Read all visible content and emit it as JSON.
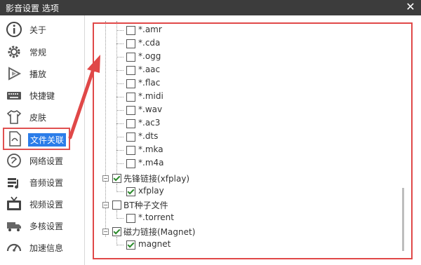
{
  "window": {
    "title": "影音设置 选项",
    "close_glyph": "✕"
  },
  "sidebar": {
    "items": [
      {
        "label": "关于",
        "icon": "info-icon"
      },
      {
        "label": "常规",
        "icon": "gear-icon"
      },
      {
        "label": "播放",
        "icon": "play-icon"
      },
      {
        "label": "快捷键",
        "icon": "keyboard-icon"
      },
      {
        "label": "皮肤",
        "icon": "tshirt-icon"
      },
      {
        "label": "文件关联",
        "icon": "file-link-icon",
        "active": true
      },
      {
        "label": "网络设置",
        "icon": "network-icon"
      },
      {
        "label": "音频设置",
        "icon": "audio-icon"
      },
      {
        "label": "视频设置",
        "icon": "tv-icon"
      },
      {
        "label": "多核设置",
        "icon": "truck-icon"
      },
      {
        "label": "加速信息",
        "icon": "speedometer-icon"
      }
    ]
  },
  "tree": {
    "audio_items": [
      "*.amr",
      "*.cda",
      "*.ogg",
      "*.aac",
      "*.flac",
      "*.midi",
      "*.wav",
      "*.ac3",
      "*.dts",
      "*.mka",
      "*.m4a"
    ],
    "xfplay_group": {
      "label": "先锋链接(xfplay)",
      "checked": true,
      "child": "xfplay",
      "child_checked": true
    },
    "bt_group": {
      "label": "BT种子文件",
      "checked": false,
      "child": "*.torrent",
      "child_checked": false
    },
    "magnet_group": {
      "label": "磁力链接(Magnet)",
      "checked": true,
      "child": "magnet",
      "child_checked": true
    }
  },
  "colors": {
    "highlight_red": "#e04848",
    "selection_blue": "#2b7de9",
    "titlebar": "#3c3c3c"
  }
}
